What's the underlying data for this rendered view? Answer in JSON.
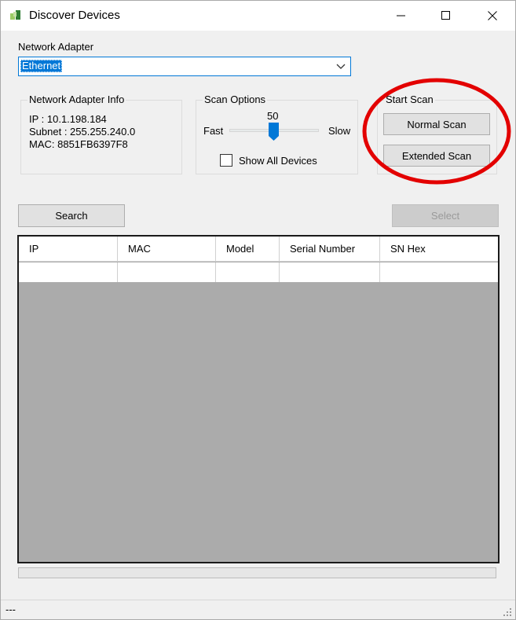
{
  "window": {
    "title": "Discover Devices"
  },
  "adapter": {
    "label": "Network Adapter",
    "selected": "Ethernet"
  },
  "adapter_info": {
    "legend": "Network Adapter Info",
    "ip": "IP : 10.1.198.184",
    "subnet": "Subnet : 255.255.240.0",
    "mac": "MAC: 8851FB6397F8"
  },
  "scan_options": {
    "legend": "Scan Options",
    "fast_label": "Fast",
    "slow_label": "Slow",
    "speed_value": "50",
    "show_all_label": "Show All Devices",
    "show_all_checked": false
  },
  "start_scan": {
    "legend": "Start Scan",
    "normal_label": "Normal Scan",
    "extended_label": "Extended Scan"
  },
  "actions": {
    "search_label": "Search",
    "select_label": "Select"
  },
  "table": {
    "columns": [
      "IP",
      "MAC",
      "Model",
      "Serial Number",
      "SN Hex"
    ]
  },
  "status": {
    "text": "---"
  },
  "colors": {
    "accent": "#0078d7",
    "highlight_circle": "#e30000",
    "grid_background": "#ababab"
  }
}
